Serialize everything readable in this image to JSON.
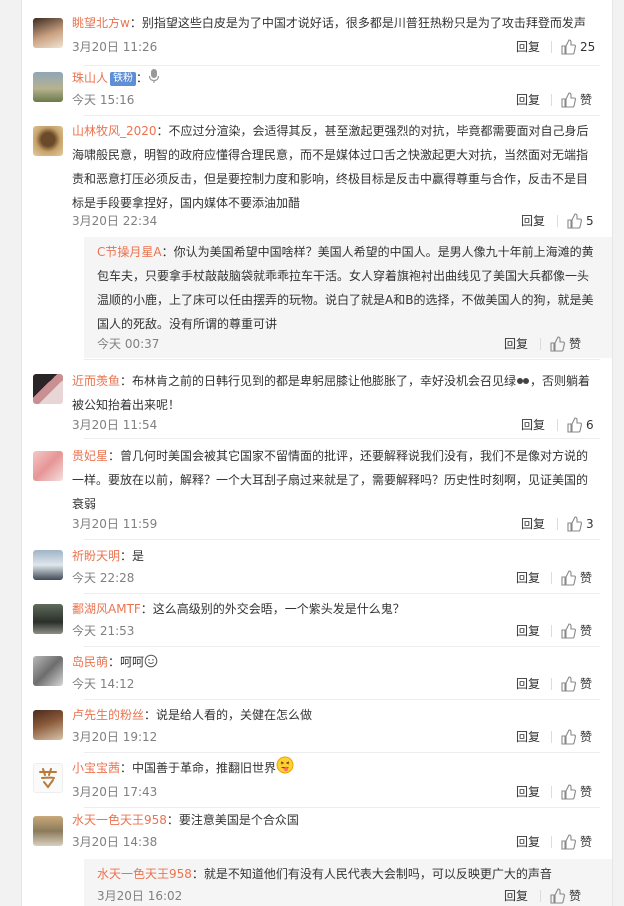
{
  "comments": [
    {
      "name": "眺望北方w",
      "text": "：别指望这些白皮是为了中国才说好话，很多都是川普狂热粉只是为了攻击拜登而发声",
      "time": "3月20日 11:26",
      "reply": "回复",
      "likes": "25"
    },
    {
      "name": "珠山人",
      "badge": "铁粉",
      "text": "：",
      "time": "今天 15:16",
      "reply": "回复",
      "likes": "赞"
    },
    {
      "name": "山林牧风_2020",
      "text": "：不应过分渲染，会适得其反，甚至激起更强烈的对抗，毕竟都需要面对自己身后海啸般民意，明智的政府应懂得合理民意，而不是媒体过口舌之快激起更大对抗，当然面对无端指责和恶意打压必须反击，但是要控制力度和影响，终极目标是反击中赢得尊重与合作，反击不是目标是手段要拿捏好，国内媒体不要添油加醋",
      "time": "3月20日 22:34",
      "reply": "回复",
      "likes": "5"
    },
    {
      "name": "C节操月星A",
      "text": "：你认为美国希望中国啥样？美国人希望的中国人。是男人像九十年前上海滩的黄包车夫，只要拿手杖敲敲脑袋就乖乖拉车干活。女人穿着旗袍衬出曲线见了美国大兵都像一头温顺的小鹿，上了床可以任由摆弄的玩物。说白了就是A和B的选择，不做美国人的狗，就是美国人的死敌。没有所谓的尊重可讲",
      "time": "今天 00:37",
      "reply": "回复",
      "likes": "赞"
    },
    {
      "name": "近而羡鱼",
      "text": "：布林肯之前的日韩行见到的都是卑躬屈膝让他膨胀了，幸好没机会召见绿",
      "text2": "，否则躺着被公知抬着出来呢！",
      "time": "3月20日 11:54",
      "reply": "回复",
      "likes": "6"
    },
    {
      "name": "贵妃星",
      "text": "：曾几何时美国会被其它国家不留情面的批评，还要解释说我们没有，我们不是像对方说的一样。要放在以前，解释？一个大耳刮子扇过来就是了，需要解释吗？历史性时刻啊，见证美国的衰弱",
      "time": "3月20日 11:59",
      "reply": "回复",
      "likes": "3"
    },
    {
      "name": "祈盼天明",
      "text": "：是",
      "time": "今天 22:28",
      "reply": "回复",
      "likes": "赞"
    },
    {
      "name": "鄱湖风AMTF",
      "text": "：这么高级别的外交会晤，一个紫头发是什么鬼？",
      "time": "今天 21:53",
      "reply": "回复",
      "likes": "赞"
    },
    {
      "name": "岛民萌",
      "text": "：呵呵",
      "time": "今天 14:12",
      "reply": "回复",
      "likes": "赞"
    },
    {
      "name": "卢先生的粉丝",
      "text": "：说是给人看的，关健在怎么做",
      "time": "3月20日 19:12",
      "reply": "回复",
      "likes": "赞"
    },
    {
      "name": "小宝宝茜",
      "text": "：中国善于革命，推翻旧世界",
      "time": "3月20日 17:43",
      "reply": "回复",
      "likes": "赞"
    },
    {
      "name": "水天一色天王958",
      "text": "：要注意美国是个合众国",
      "time": "3月20日 14:38",
      "reply": "回复",
      "likes": "赞"
    },
    {
      "name": "水天一色天王958",
      "text": "：就是不知道他们有没有人民代表大会制吗，可以反映更广大的声音",
      "time": "3月20日 16:02",
      "reply": "回复",
      "likes": "赞"
    }
  ],
  "colors": {
    "name": "#eb7350",
    "meta": "#808080",
    "badge": "#5d8ed6"
  }
}
